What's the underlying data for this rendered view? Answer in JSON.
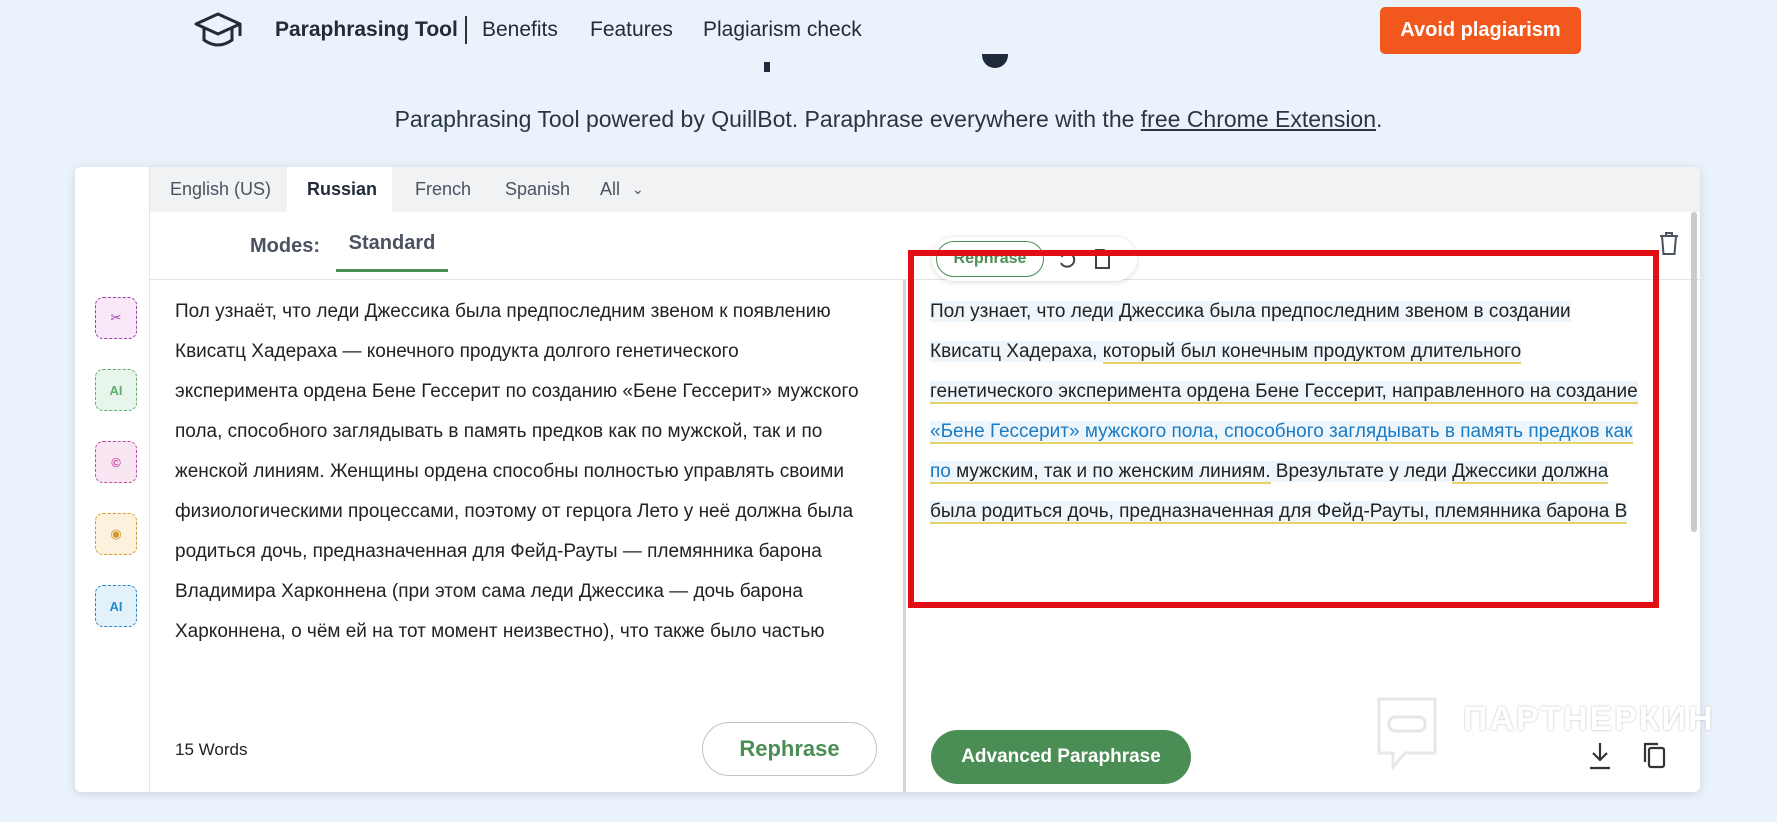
{
  "nav": {
    "brand": "Paraphrasing Tool",
    "links": [
      "Benefits",
      "Features",
      "Plagiarism check"
    ],
    "cta": "Avoid plagiarism"
  },
  "subtitle": {
    "text": "Paraphrasing Tool powered by QuillBot. Paraphrase everywhere with the ",
    "link": "free Chrome Extension",
    "end": "."
  },
  "languages": [
    "English (US)",
    "Russian",
    "French",
    "Spanish",
    "All"
  ],
  "active_language": "Russian",
  "modes": {
    "label": "Modes:",
    "current": "Standard"
  },
  "input": {
    "text": "Пол узнаёт, что леди Джессика была предпоследним звеном к появлению Квисатц Хадераха — конечного продукта долгого генетического эксперимента ордена Бене Гессерит по созданию «Бене Гессерит» мужского пола, способного заглядывать в память предков как по мужской, так и по женской линиям. Женщины ордена способны полностью управлять своими физиологическими процессами, поэтому от герцога Лето у неё должна была родиться дочь, предназначенная для Фейд-Рауты — племянника барона Владимира Харконнена (при этом сама леди Джессика — дочь барона Харконнена, о чём ей на тот момент неизвестно), что также было частью генетической программы Бене Гессерит. Но из-за любви к",
    "word_count": "15 Words",
    "rephrase_button": "Rephrase"
  },
  "output": {
    "mini_rephrase": "Rephrase",
    "segments": [
      {
        "text": "Пол узнает, что леди Джессика была предпоследним звеном в создании Квисатц Хадераха, ",
        "style": "plain"
      },
      {
        "text": "который был конечным продуктом длительного генетического эксперимента ордена Бене Гессерит, направленного на создание ",
        "style": "changed"
      },
      {
        "text": "«Бене Гессерит» мужского пола, способного заглядывать в память предков как по",
        "style": "structure"
      },
      {
        "text": " мужским, так и по женским линиям.",
        "style": "changed"
      },
      {
        "text": " Врезультате у леди ",
        "style": "plain"
      },
      {
        "text": "Джессики должна была родиться дочь, предназначенная для Фейд-Рауты, племянника барона В",
        "style": "changed"
      }
    ],
    "advanced_button": "Advanced Paraphrase"
  },
  "rail_icons": [
    {
      "name": "split-sentence-icon",
      "label": "✂",
      "color": "#9a3fae",
      "bg": "#f7e7f7"
    },
    {
      "name": "ai-detector-icon",
      "label": "AI",
      "color": "#5fae6a",
      "bg": "#e8f5ea"
    },
    {
      "name": "plagiarism-icon",
      "label": "©",
      "color": "#c24aa7",
      "bg": "#f9e6f3"
    },
    {
      "name": "eye-icon",
      "label": "◉",
      "color": "#d69a2c",
      "bg": "#fcf1dc"
    },
    {
      "name": "ai-search-icon",
      "label": "AI",
      "color": "#2b88c8",
      "bg": "#e3f1fb"
    }
  ],
  "watermark": "ПАРТНЕРКИН",
  "colors": {
    "accent": "#4a8e55",
    "cta": "#f2581e",
    "highlight": "#e10f14"
  }
}
